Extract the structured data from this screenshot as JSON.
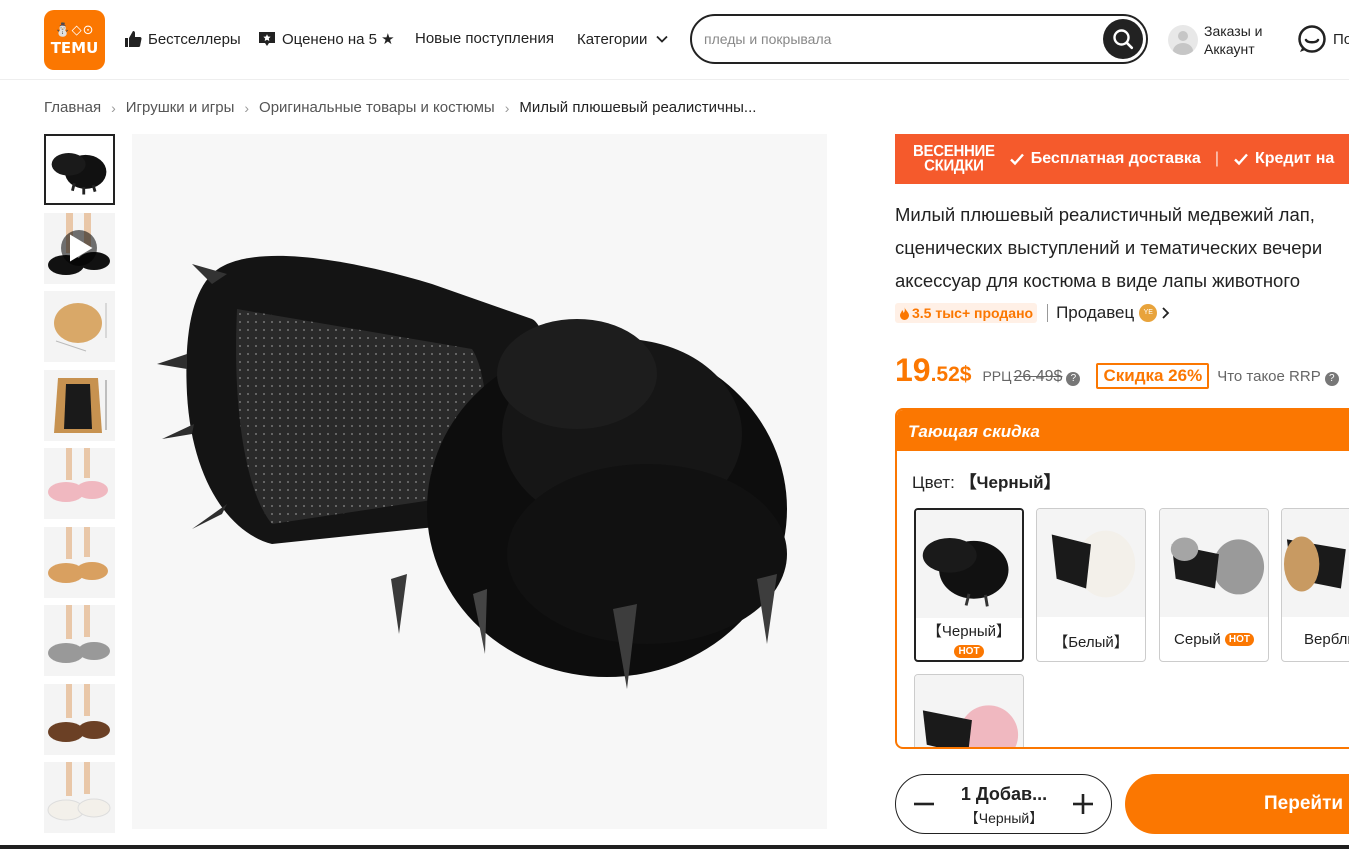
{
  "logo": {
    "mark": "⛄◇⊙",
    "text": "TEMU"
  },
  "nav": {
    "bestsellers": "Бестселлеры",
    "rated": "Оценено на 5 ★",
    "new_arrivals": "Новые поступления",
    "categories": "Категории"
  },
  "search": {
    "placeholder": "пледы и покрывала"
  },
  "account": {
    "label_line1": "Заказы и",
    "label_line2": "Аккаунт"
  },
  "support": {
    "label": "По"
  },
  "breadcrumb": {
    "items": [
      "Главная",
      "Игрушки и игры",
      "Оригинальные товары и костюмы",
      "Милый плюшевый реалистичны..."
    ]
  },
  "promo": {
    "badge_line1": "ВЕСЕННИЕ",
    "badge_line2": "СКИДКИ",
    "free_shipping": "Бесплатная доставка",
    "credit": "Кредит на"
  },
  "product": {
    "title_lines": [
      "Милый плюшевый реалистичный медвежий лап,",
      "сценических выступлений и тематических вечери",
      "аксессуар для костюма в виде лапы животного"
    ],
    "sold": "3.5 тыс+ продано",
    "seller_label": "Продавец",
    "seller_logo": "YE",
    "price_int": "19",
    "price_frac": ".52$",
    "rrp_label": "РРЦ",
    "rrp_value": "26.49$",
    "discount": "Скидка 26%",
    "rrp_help": "Что такое RRP"
  },
  "flash": {
    "title": "Тающая скидка",
    "color_label": "Цвет:",
    "color_value": "【Черный】",
    "hot_label": "HOT",
    "swatches": [
      {
        "name": "【Черный】",
        "hot": true,
        "fur": "#111111"
      },
      {
        "name": "【Белый】",
        "hot": false,
        "fur": "#f3f0ea"
      },
      {
        "name": "Серый",
        "hot": true,
        "fur": "#9a9a9a"
      },
      {
        "name": "Верблю",
        "hot": false,
        "fur": "#c89a62"
      },
      {
        "name": "",
        "hot": false,
        "fur": "#f0b8c0"
      }
    ]
  },
  "cart": {
    "qty_label": "1 Добав...",
    "qty_variant": "【Черный】",
    "go_label": "Перейти"
  },
  "thumbnails": [
    "#111111",
    "#111111",
    "#d9a868",
    "#c79250",
    "#f0b8c0",
    "#d9a060",
    "#999999",
    "#6b4025",
    "#f3f0ea"
  ],
  "colors": {
    "accent": "#fb7701",
    "promo": "#f55a2c",
    "text": "#222222"
  }
}
